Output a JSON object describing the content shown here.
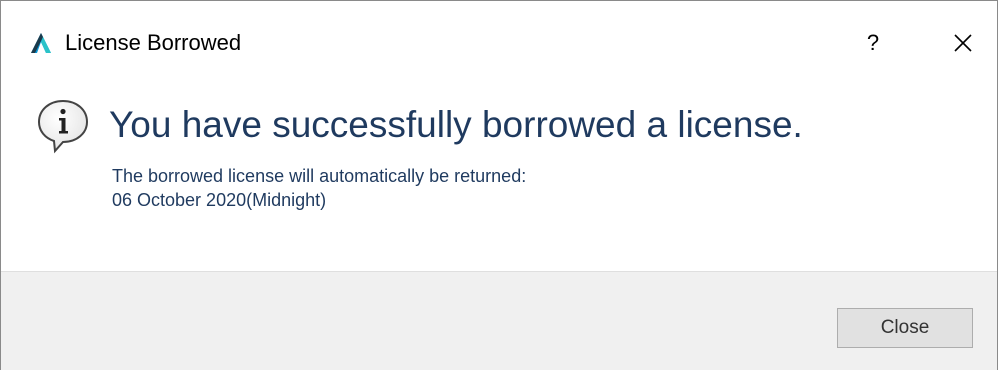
{
  "window": {
    "title": "License Borrowed",
    "help_label": "?",
    "close_icon": "close-icon",
    "logo_icon": "autodesk-logo-icon"
  },
  "message": {
    "icon": "info-icon",
    "headline": "You have successfully borrowed a license.",
    "detail_line_1": "The borrowed license will automatically be returned:",
    "detail_line_2": "06 October 2020(Midnight)"
  },
  "footer": {
    "close_button_label": "Close"
  },
  "colors": {
    "logo_teal": "#0696d7",
    "logo_dark": "#1b3a4b",
    "text_blue": "#1f3a5f",
    "footer_bg": "#f0f0f0",
    "button_bg": "#e1e1e1",
    "button_border": "#adadad"
  }
}
